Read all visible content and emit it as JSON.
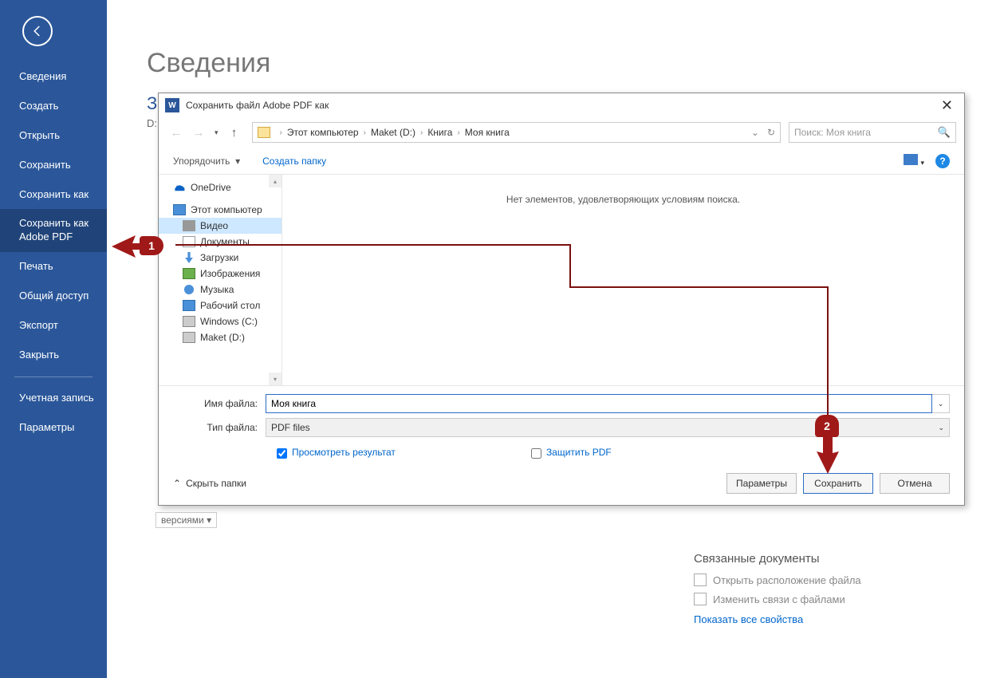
{
  "sidebar": {
    "items": [
      {
        "label": "Сведения",
        "active": false
      },
      {
        "label": "Создать"
      },
      {
        "label": "Открыть"
      },
      {
        "label": "Сохранить"
      },
      {
        "label": "Сохранить как"
      },
      {
        "label": "Сохранить как Adobe PDF",
        "active": true
      },
      {
        "label": "Печать"
      },
      {
        "label": "Общий доступ"
      },
      {
        "label": "Экспорт"
      },
      {
        "label": "Закрыть"
      }
    ],
    "items2": [
      {
        "label": "Учетная запись"
      },
      {
        "label": "Параметры"
      }
    ]
  },
  "main": {
    "heading": "Сведения",
    "truncated_line1": "За",
    "truncated_line2": "D:",
    "versions_btn": "версиями"
  },
  "related": {
    "heading": "Связанные документы",
    "open_location": "Открыть расположение файла",
    "edit_links": "Изменить связи с файлами",
    "show_all": "Показать все свойства"
  },
  "dialog": {
    "title": "Сохранить файл Adobe PDF как",
    "breadcrumbs": [
      "Этот компьютер",
      "Maket (D:)",
      "Книга",
      "Моя книга"
    ],
    "search_placeholder": "Поиск: Моя книга",
    "toolbar_organize": "Упорядочить",
    "toolbar_newfolder": "Создать папку",
    "tree": [
      {
        "label": "OneDrive",
        "icon": "onedrive"
      },
      {
        "label": "Этот компьютер",
        "icon": "computer"
      },
      {
        "label": "Видео",
        "icon": "video",
        "indent": true,
        "selected": true
      },
      {
        "label": "Документы",
        "icon": "doc",
        "indent": true
      },
      {
        "label": "Загрузки",
        "icon": "download",
        "indent": true
      },
      {
        "label": "Изображения",
        "icon": "image",
        "indent": true
      },
      {
        "label": "Музыка",
        "icon": "music",
        "indent": true
      },
      {
        "label": "Рабочий стол",
        "icon": "desktop",
        "indent": true
      },
      {
        "label": "Windows (C:)",
        "icon": "drive",
        "indent": true
      },
      {
        "label": "Maket (D:)",
        "icon": "drive",
        "indent": true
      }
    ],
    "empty": "Нет элементов, удовлетворяющих условиям поиска.",
    "filename_label": "Имя файла:",
    "filename_value": "Моя книга",
    "filetype_label": "Тип файла:",
    "filetype_value": "PDF files",
    "check_preview": "Просмотреть результат",
    "check_protect": "Защитить PDF",
    "hide_folders": "Скрыть папки",
    "btn_params": "Параметры",
    "btn_save": "Сохранить",
    "btn_cancel": "Отмена"
  },
  "callouts": {
    "c1": "1",
    "c2": "2"
  }
}
